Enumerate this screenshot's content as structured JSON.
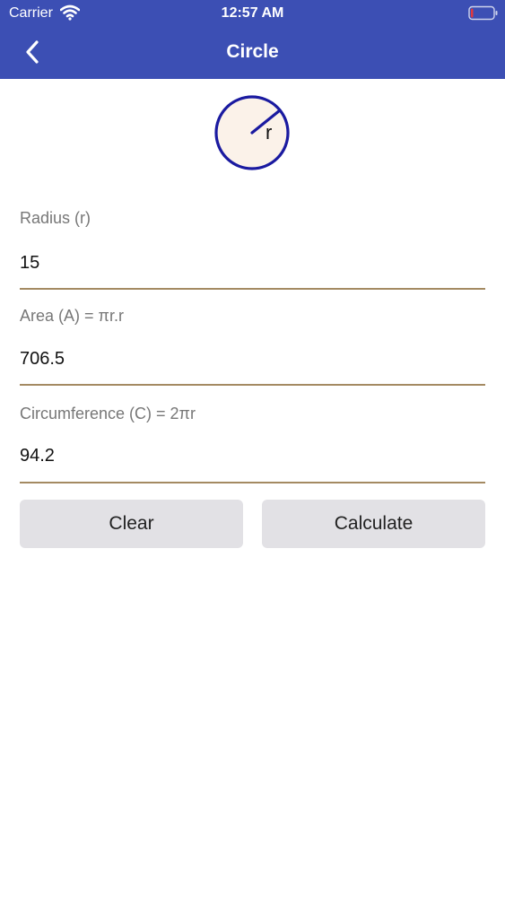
{
  "status_bar": {
    "carrier": "Carrier",
    "time": "12:57 AM",
    "wifi_icon": "wifi-icon",
    "battery_icon": "battery-icon",
    "battery_level": 0.1,
    "battery_color": "#e0393e"
  },
  "nav": {
    "title": "Circle",
    "back_icon": "chevron-left-icon",
    "bar_color": "#3c4fb4"
  },
  "figure": {
    "radius_label": "r",
    "stroke_color": "#1a1aa0",
    "fill_color": "#fbf2e9"
  },
  "fields": {
    "radius": {
      "label": "Radius (r)",
      "value": "15"
    },
    "area": {
      "label": "Area (A) = πr.r",
      "value": "706.5"
    },
    "circumference": {
      "label": "Circumference (C) = 2πr",
      "value": "94.2"
    }
  },
  "buttons": {
    "clear_label": "Clear",
    "calculate_label": "Calculate"
  },
  "colors": {
    "underline": "#a48a62",
    "button_bg": "#e2e1e5"
  }
}
